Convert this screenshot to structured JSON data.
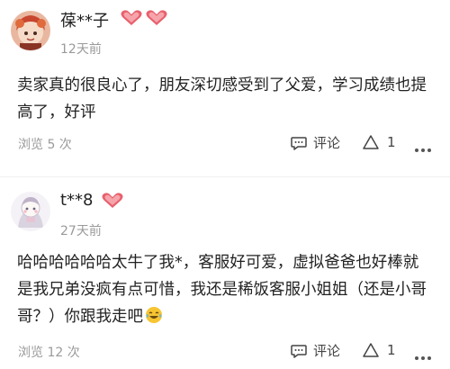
{
  "reviews": [
    {
      "user_name": "葆**子",
      "time": "12天前",
      "text": "卖家真的很良心了，朋友深切感受到了父爱，学习成绩也提高了，好评",
      "views": "浏览 5 次",
      "comment_label": "评论",
      "like_count": "1"
    },
    {
      "user_name": "t**8",
      "time": "27天前",
      "text": "哈哈哈哈哈哈太牛了我*，客服好可爱，虚拟爸爸也好棒就是我兄弟没疯有点可惜，我还是稀饭客服小姐姐（还是小哥哥？）你跟我走吧",
      "views": "浏览 12 次",
      "comment_label": "评论",
      "like_count": "1"
    }
  ],
  "colors": {
    "badge": "#e8606d",
    "muted": "#9a9a9a",
    "text": "#222222"
  },
  "icons": {
    "badge": "heart-badge-icon",
    "comment": "comment-icon",
    "like": "thumb-up-icon",
    "more": "more-dots-icon",
    "emoji": "laughing-tears-emoji"
  }
}
